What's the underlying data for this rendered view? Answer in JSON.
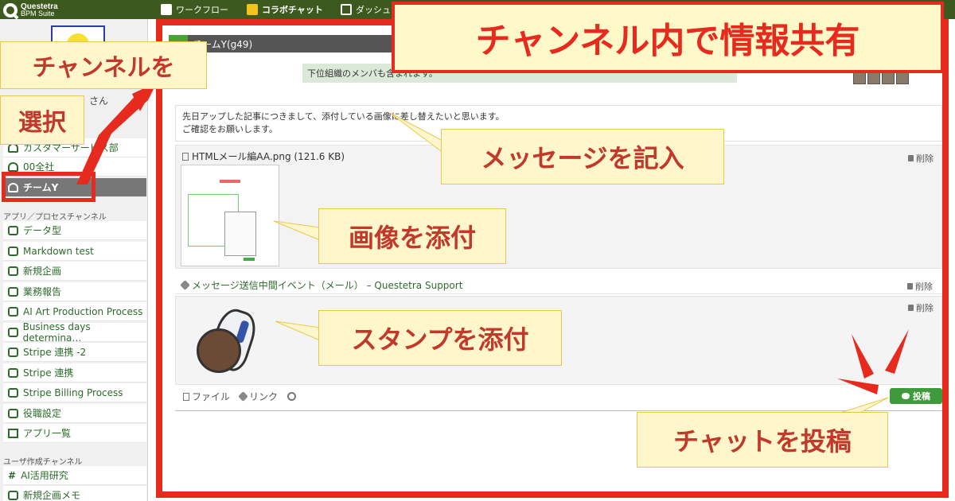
{
  "topbar": {
    "logo": {
      "line1": "Questetra",
      "line2": "BPM Suite"
    },
    "tabs": [
      {
        "label": "ワークフロー"
      },
      {
        "label": "コラボチャット"
      },
      {
        "label": "ダッシュ"
      }
    ]
  },
  "sidebar": {
    "user_name": "さん",
    "channels": [
      {
        "label": "カスタマーサービス部"
      },
      {
        "label": "00全社"
      },
      {
        "label": "チームY"
      }
    ],
    "app_section_label": "アプリ／プロセスチャンネル",
    "apps": [
      {
        "label": "データ型"
      },
      {
        "label": "Markdown test"
      },
      {
        "label": "新規企画"
      },
      {
        "label": "業務報告"
      },
      {
        "label": "AI Art Production Process"
      },
      {
        "label": "Business days determina…"
      },
      {
        "label": "Stripe 連携 -2"
      },
      {
        "label": "Stripe 連携"
      },
      {
        "label": "Stripe Billing Process"
      },
      {
        "label": "役職設定"
      },
      {
        "label": "アプリ一覧"
      }
    ],
    "user_section_label": "ユーザ作成チャンネル",
    "user_channels": [
      {
        "label": "AI活用研究"
      },
      {
        "label": "新規企画メモ"
      }
    ]
  },
  "main": {
    "channel_title": "チームY(g49)",
    "info_strip": "下位組織のメンバも含まれます。",
    "message_text_line1": "先日アップした記事につきまして、添付している画像に差し替えたいと思います。",
    "message_text_line2": "ご確認をお願いします。",
    "file_name": "HTMLメール編AA.png (121.6 KB)",
    "delete_label": "削除",
    "link_text": "メッセージ送信中間イベント（メール） – Questetra Support",
    "toolbar": {
      "file_label": "ファイル",
      "link_label": "リンク"
    },
    "post_label": "投稿"
  },
  "callouts": {
    "title": "チャンネル内で情報共有",
    "channel": "チャンネルを",
    "select": "選択",
    "message": "メッセージを記入",
    "image": "画像を添付",
    "stamp": "スタンプを添付",
    "post": "チャットを投稿"
  },
  "colors": {
    "accent_red": "#e62a1d",
    "callout_bg": "#fff6cc",
    "header_green": "#3d5a1e",
    "post_green": "#3e9a3a"
  }
}
